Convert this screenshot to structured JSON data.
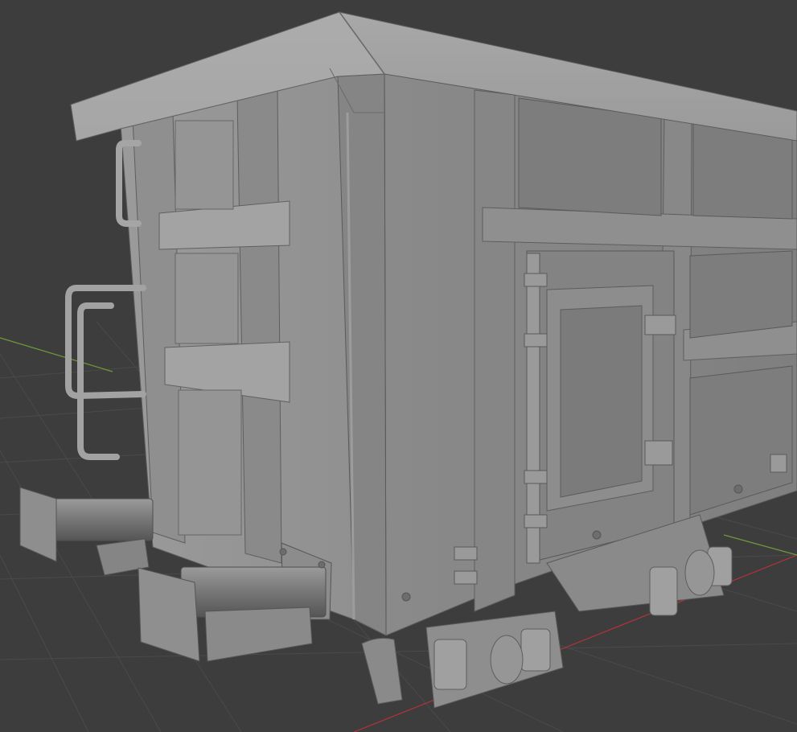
{
  "viewport": {
    "background": "#3d3d3d",
    "grid_color": "#4a4a4a",
    "x_axis_color": "#b5323a",
    "y_axis_color": "#6f9a3c",
    "model_base_color": "#8c8c8c"
  }
}
